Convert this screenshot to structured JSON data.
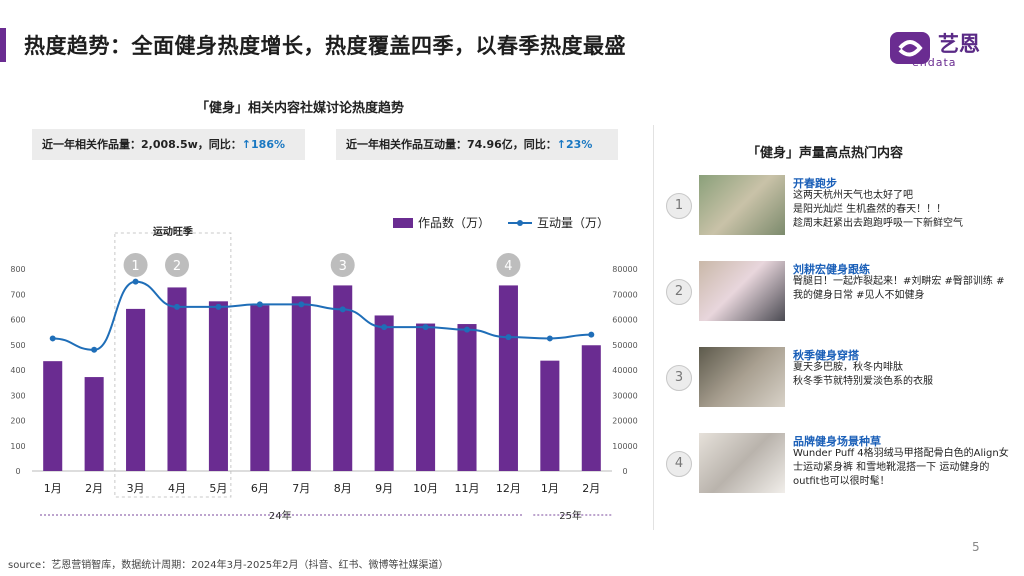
{
  "header": {
    "title": "热度趋势：全面健身热度增长，热度覆盖四季，以春季热度最盛",
    "logo_text": "艺恩",
    "logo_sub": "endata"
  },
  "left": {
    "chart_title": "「健身」相关内容社媒讨论热度趋势",
    "stat1_label": "近一年相关作品量：2,008.5w，同比：",
    "stat1_value": "↑186%",
    "stat2_label": "近一年相关作品互动量：74.96亿，同比：",
    "stat2_value": "↑23%",
    "season_label": "运动旺季",
    "year_2024": "24年",
    "year_2025": "25年"
  },
  "chart_data": {
    "type": "bar",
    "categories": [
      "1月",
      "2月",
      "3月",
      "4月",
      "5月",
      "6月",
      "7月",
      "8月",
      "9月",
      "10月",
      "11月",
      "12月",
      "1月",
      "2月"
    ],
    "series": [
      {
        "name": "作品数（万）",
        "type": "bar",
        "axis": "left",
        "color": "#6a2c91",
        "values": [
          435,
          372,
          642,
          727,
          672,
          656,
          692,
          735,
          616,
          584,
          582,
          735,
          437,
          498
        ]
      },
      {
        "name": "互动量（万）",
        "type": "line",
        "axis": "right",
        "color": "#1f6eb8",
        "values": [
          52500,
          48000,
          75000,
          65000,
          65000,
          66000,
          66000,
          64000,
          57000,
          57000,
          56000,
          53000,
          52500,
          54000
        ]
      }
    ],
    "ylim_left": [
      0,
      800
    ],
    "yticks_left": [
      0,
      100,
      200,
      300,
      400,
      500,
      600,
      700,
      800
    ],
    "ylim_right": [
      0,
      80000
    ],
    "yticks_right": [
      0,
      10000,
      20000,
      30000,
      40000,
      50000,
      60000,
      70000,
      80000
    ],
    "legend": "top-right",
    "markers": [
      {
        "label": "1",
        "index": 2
      },
      {
        "label": "2",
        "index": 3
      },
      {
        "label": "3",
        "index": 7
      },
      {
        "label": "4",
        "index": 11
      }
    ]
  },
  "right": {
    "title": "「健身」声量高点热门内容",
    "items": [
      {
        "num": "1",
        "title": "开春跑步",
        "desc": "这两天杭州天气也太好了吧\n是阳光灿烂 生机盎然的春天！！！\n趁周末赶紧出去跑跑呼吸一下新鲜空气"
      },
      {
        "num": "2",
        "title": "刘耕宏健身跟练",
        "desc": "臀腿日！一起炸裂起来！#刘畊宏 #臀部训练 #我的健身日常 #见人不如健身"
      },
      {
        "num": "3",
        "title": "秋季健身穿搭",
        "desc": "夏天多巴胺，秋冬内啡肽\n秋冬季节就特别爱淡色系的衣服"
      },
      {
        "num": "4",
        "title": "品牌健身场景种草",
        "desc": " Wunder Puff 4格羽绒马甲搭配骨白色的Align女士运动紧身裤 和雪地靴混搭一下 运动健身的outfit也可以很时髦！"
      }
    ]
  },
  "footer": {
    "source": "source：艺恩营销智库，数据统计周期：2024年3月-2025年2月（抖音、红书、微博等社媒渠道）",
    "page": "5"
  }
}
